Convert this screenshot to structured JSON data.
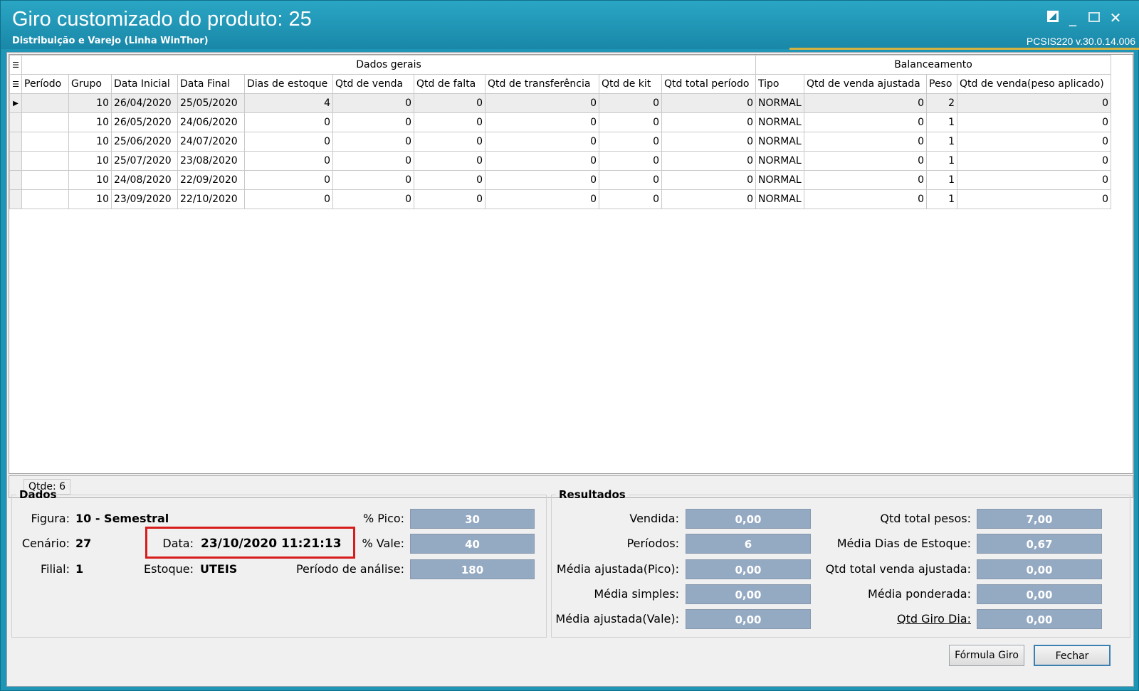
{
  "window": {
    "title": "Giro customizado do produto: 25",
    "subtitle": "Distribuição e Varejo (Linha WinThor)",
    "version": "PCSIS220  v.30.0.14.006"
  },
  "grid": {
    "bands": {
      "general": "Dados gerais",
      "balance": "Balanceamento"
    },
    "columns": [
      "Período",
      "Grupo",
      "Data Inicial",
      "Data Final",
      "Dias de estoque",
      "Qtd de venda",
      "Qtd de falta",
      "Qtd de transferência",
      "Qtd de kit",
      "Qtd total período",
      "Tipo",
      "Qtd de venda ajustada",
      "Peso",
      "Qtd de venda(peso aplicado)"
    ],
    "rows": [
      [
        "",
        "10",
        "26/04/2020",
        "25/05/2020",
        "4",
        "0",
        "0",
        "0",
        "0",
        "0",
        "NORMAL",
        "0",
        "2",
        "0"
      ],
      [
        "",
        "10",
        "26/05/2020",
        "24/06/2020",
        "0",
        "0",
        "0",
        "0",
        "0",
        "0",
        "NORMAL",
        "0",
        "1",
        "0"
      ],
      [
        "",
        "10",
        "25/06/2020",
        "24/07/2020",
        "0",
        "0",
        "0",
        "0",
        "0",
        "0",
        "NORMAL",
        "0",
        "1",
        "0"
      ],
      [
        "",
        "10",
        "25/07/2020",
        "23/08/2020",
        "0",
        "0",
        "0",
        "0",
        "0",
        "0",
        "NORMAL",
        "0",
        "1",
        "0"
      ],
      [
        "",
        "10",
        "24/08/2020",
        "22/09/2020",
        "0",
        "0",
        "0",
        "0",
        "0",
        "0",
        "NORMAL",
        "0",
        "1",
        "0"
      ],
      [
        "",
        "10",
        "23/09/2020",
        "22/10/2020",
        "0",
        "0",
        "0",
        "0",
        "0",
        "0",
        "NORMAL",
        "0",
        "1",
        "0"
      ]
    ],
    "status": "Qtde: 6"
  },
  "dados": {
    "legend": "Dados",
    "figura_label": "Figura:",
    "figura_value": "10 - Semestral",
    "cenario_label": "Cenário:",
    "cenario_value": "27",
    "filial_label": "Filial:",
    "filial_value": "1",
    "data_label": "Data:",
    "data_value": "23/10/2020 11:21:13",
    "estoque_label": "Estoque:",
    "estoque_value": "UTEIS",
    "pico_label": "% Pico:",
    "pico_value": "30",
    "vale_label": "% Vale:",
    "vale_value": "40",
    "periodo_label": "Período de análise:",
    "periodo_value": "180"
  },
  "resultados": {
    "legend": "Resultados",
    "vendida_label": "Vendida:",
    "vendida_value": "0,00",
    "periodos_label": "Períodos:",
    "periodos_value": "6",
    "media_pico_label": "Média ajustada(Pico):",
    "media_pico_value": "0,00",
    "media_simples_label": "Média simples:",
    "media_simples_value": "0,00",
    "media_vale_label": "Média ajustada(Vale):",
    "media_vale_value": "0,00",
    "qtd_pesos_label": "Qtd total pesos:",
    "qtd_pesos_value": "7,00",
    "media_dias_label": "Média Dias de Estoque:",
    "media_dias_value": "0,67",
    "qtd_venda_aj_label": "Qtd total venda ajustada:",
    "qtd_venda_aj_value": "0,00",
    "media_ponderada_label": "Média ponderada:",
    "media_ponderada_value": "0,00",
    "giro_dia_label": "Qtd Giro Dia:",
    "giro_dia_value": "0,00"
  },
  "buttons": {
    "formula": "Fórmula Giro",
    "fechar": "Fechar"
  },
  "colors": {
    "title_bar": "#1f96b6",
    "value_box": "#94a9c2",
    "highlight": "#d81c1c"
  }
}
